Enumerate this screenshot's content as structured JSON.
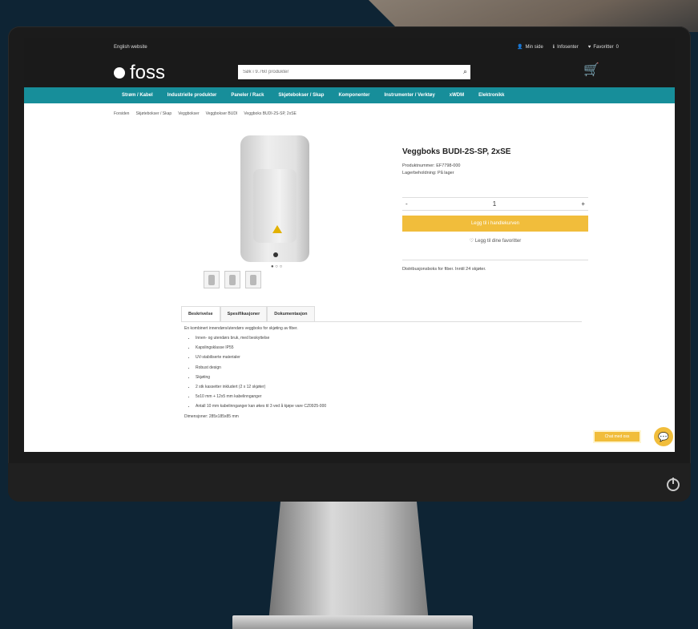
{
  "store": {
    "english_link": "English website",
    "top_links": [
      {
        "icon": "user-icon",
        "label": "Min side"
      },
      {
        "icon": "info-icon",
        "label": "Infosenter"
      },
      {
        "icon": "heart-icon",
        "label": "Favoritter"
      }
    ],
    "favorites_count": "0",
    "logo_text": "foss",
    "search_placeholder": "Søk i 9.760 produkter",
    "nav": [
      "Strøm / Kabel",
      "Industrielle produkter",
      "Paneler / Rack",
      "Skjøtebokser / Skap",
      "Komponenter",
      "Instrumenter / Verktøy",
      "xWDM",
      "Elektronikk"
    ]
  },
  "breadcrumbs": [
    "Forsiden",
    "Skjøtebokser / Skap",
    "Veggbokser",
    "Veggbokser BUDI",
    "Veggboks BUDI-2S-SP, 2xSE"
  ],
  "product": {
    "title": "Veggboks BUDI-2S-SP, 2xSE",
    "sku_label": "Produktnummer:",
    "sku": "EF7798-000",
    "stock_label": "Lagerbeholdning:",
    "stock": "På lager",
    "qty_minus": "-",
    "qty_value": "1",
    "qty_plus": "+",
    "buy_label": "Legg til i handlekurven",
    "fav_label": "Legg til dine favoritter",
    "short_desc": "Distribusjonsboks for fiber. Inntil 24 skjøter.",
    "pager": "● ○ ○"
  },
  "tabs": [
    "Beskrivelse",
    "Spesifikasjoner",
    "Dokumentasjon"
  ],
  "description": {
    "intro": "En kombinert innendørs/utendørs veggboks for skjøting av fiber.",
    "bullets": [
      "Innen- og utendørs bruk, med beskyttelse",
      "Kapslingsklasse IP55",
      "UV-stabiliserte materialer",
      "Robust design",
      "Skjøting",
      "2 stk kassetter inkludert (2 x 12 skjøter)",
      "5x10 mm + 12x5 mm kabelinnganger",
      "Antall 10 mm kabelinnganger kan økes til 3 ved å kjøpe vare CZ0925-000"
    ],
    "dimensions": "Dimensjoner: 285x185x85 mm"
  },
  "chat_button": "Chat med oss"
}
